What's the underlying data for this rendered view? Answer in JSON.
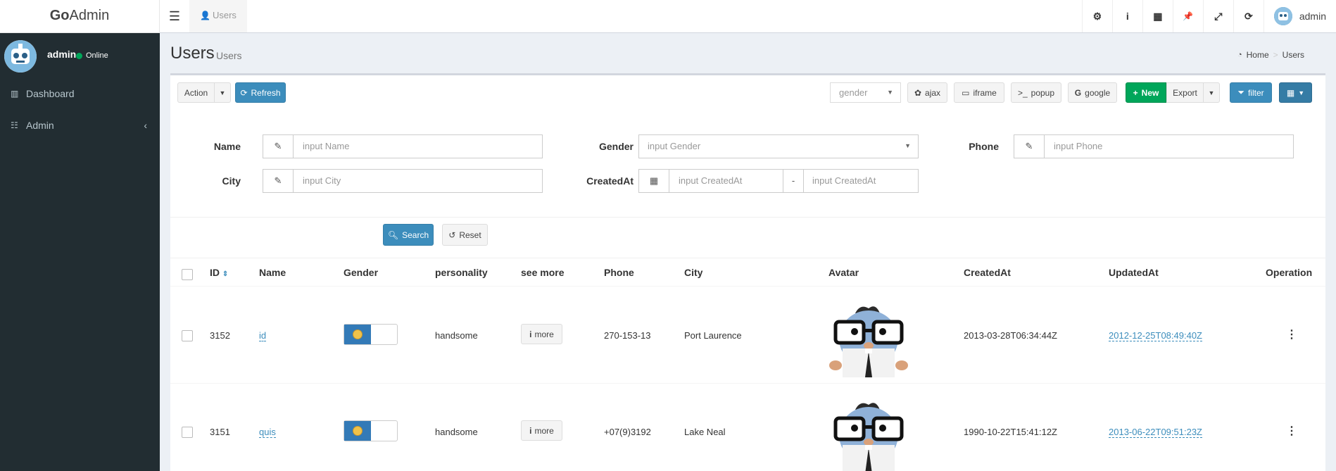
{
  "brand": {
    "bold": "Go",
    "rest": "Admin"
  },
  "topbar": {
    "tab_label": "Users",
    "icons": [
      "gear-icon",
      "info-icon",
      "grid-icon",
      "pin-icon",
      "expand-icon",
      "refresh-icon"
    ],
    "icon_glyphs": [
      "⚙",
      "i",
      "▦",
      "📌",
      "⤢",
      "⟳"
    ],
    "user_name": "admin"
  },
  "sidebar": {
    "user_name": "admin",
    "status": "Online",
    "items": [
      {
        "label": "Dashboard",
        "icon": "bar-chart-icon"
      },
      {
        "label": "Admin",
        "icon": "tasks-icon"
      }
    ]
  },
  "header": {
    "title": "Users",
    "subtitle": "Users",
    "breadcrumb": [
      "Home",
      "Users"
    ]
  },
  "toolbar": {
    "action_label": "Action",
    "refresh_label": "Refresh",
    "gender_select": "gender",
    "ajax_label": "ajax",
    "iframe_label": "iframe",
    "popup_label": "popup",
    "google_label": "google",
    "new_label": "New",
    "export_label": "Export",
    "filter_label": "filter"
  },
  "filters": {
    "name_label": "Name",
    "name_placeholder": "input Name",
    "gender_label": "Gender",
    "gender_placeholder": "input Gender",
    "phone_label": "Phone",
    "phone_placeholder": "input Phone",
    "city_label": "City",
    "city_placeholder": "input City",
    "createdat_label": "CreatedAt",
    "createdat_start_placeholder": "input CreatedAt",
    "createdat_end_placeholder": "input CreatedAt",
    "range_sep": "-",
    "search_label": "Search",
    "reset_label": "Reset"
  },
  "table": {
    "columns": [
      "ID",
      "Name",
      "Gender",
      "personality",
      "see more",
      "Phone",
      "City",
      "Avatar",
      "CreatedAt",
      "UpdatedAt",
      "Operation"
    ],
    "more_label": "more",
    "rows": [
      {
        "id": "3152",
        "name": "id",
        "personality": "handsome",
        "phone": "270-153-13",
        "city": "Port Laurence",
        "created_at": "2013-03-28T06:34:44Z",
        "updated_at": "2012-12-25T08:49:40Z"
      },
      {
        "id": "3151",
        "name": "quis",
        "personality": "handsome",
        "phone": "+07(9)3192",
        "city": "Lake Neal",
        "created_at": "1990-10-22T15:41:12Z",
        "updated_at": "2013-06-22T09:51:23Z"
      }
    ]
  },
  "colors": {
    "sidebar": "#222d32",
    "primary": "#3c8dbc",
    "success": "#00a65a"
  }
}
